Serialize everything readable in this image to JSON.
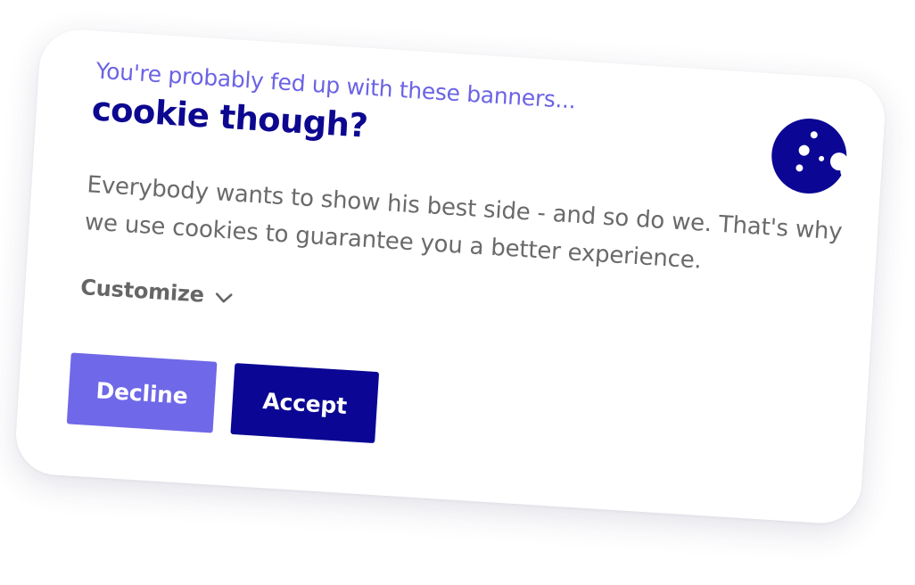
{
  "banner": {
    "subtitle": "You're probably fed up with these banners...",
    "title": "cookie though?",
    "body": "Everybody wants to show his best side - and so do we. That's why we use cookies to guarantee you a better experience.",
    "customize_label": "Customize",
    "decline_label": "Decline",
    "accept_label": "Accept",
    "icons": {
      "cookie": "cookie-icon",
      "chevron": "chevron-down-icon"
    },
    "colors": {
      "subtitle": "#6b63e5",
      "title": "#0d0890",
      "body_text": "#6a6a6a",
      "decline_button": "#6f68e8",
      "accept_button": "#0b0794",
      "cookie": "#0b0794"
    }
  }
}
